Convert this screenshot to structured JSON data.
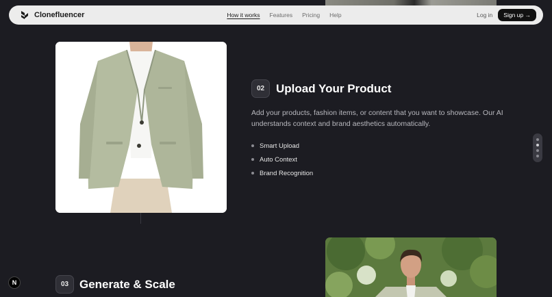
{
  "nav": {
    "brand": "Clonefluencer",
    "links": [
      {
        "label": "How it works",
        "active": true
      },
      {
        "label": "Features",
        "active": false
      },
      {
        "label": "Pricing",
        "active": false
      },
      {
        "label": "Help",
        "active": false
      }
    ],
    "login_label": "Log in",
    "signup_label": "Sign up →"
  },
  "step2": {
    "number": "02",
    "title": "Upload Your Product",
    "description": "Add your products, fashion items, or content that you want to showcase. Our AI understands context and brand aesthetics automatically.",
    "features": [
      "Smart Upload",
      "Auto Context",
      "Brand Recognition"
    ]
  },
  "step3": {
    "number": "03",
    "title": "Generate & Scale"
  },
  "dev_indicator": "N",
  "colors": {
    "background": "#1c1c22",
    "nav_bg": "#ececec",
    "blazer": "#b4bca0",
    "foliage": "#5c7a3e"
  }
}
